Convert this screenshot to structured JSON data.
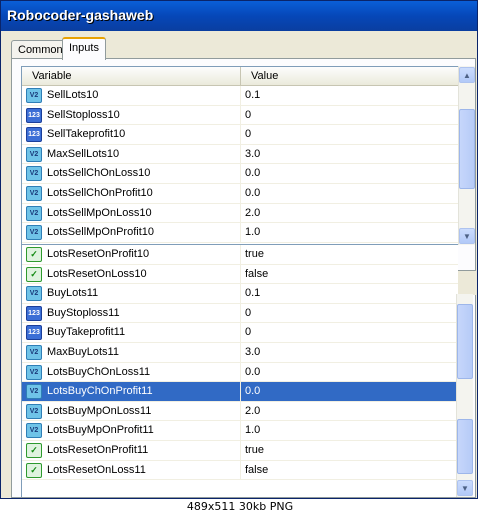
{
  "window": {
    "title": "Robocoder-gashaweb"
  },
  "tabs": [
    {
      "label": "Common",
      "active": false
    },
    {
      "label": "Inputs",
      "active": true
    }
  ],
  "table": {
    "headers": {
      "variable": "Variable",
      "value": "Value"
    },
    "top_rows": [
      {
        "icon": "double",
        "name": "SellLots10",
        "value": "0.1"
      },
      {
        "icon": "int",
        "name": "SellStoploss10",
        "value": "0"
      },
      {
        "icon": "int",
        "name": "SellTakeprofit10",
        "value": "0"
      },
      {
        "icon": "double",
        "name": "MaxSellLots10",
        "value": "3.0"
      },
      {
        "icon": "double",
        "name": "LotsSellChOnLoss10",
        "value": "0.0"
      },
      {
        "icon": "double",
        "name": "LotsSellChOnProfit10",
        "value": "0.0"
      },
      {
        "icon": "double",
        "name": "LotsSellMpOnLoss10",
        "value": "2.0"
      },
      {
        "icon": "double",
        "name": "LotsSellMpOnProfit10",
        "value": "1.0"
      }
    ],
    "bottom_rows": [
      {
        "icon": "bool",
        "name": "LotsResetOnProfit10",
        "value": "true"
      },
      {
        "icon": "bool",
        "name": "LotsResetOnLoss10",
        "value": "false"
      },
      {
        "icon": "double",
        "name": "BuyLots11",
        "value": "0.1"
      },
      {
        "icon": "int",
        "name": "BuyStoploss11",
        "value": "0"
      },
      {
        "icon": "int",
        "name": "BuyTakeprofit11",
        "value": "0"
      },
      {
        "icon": "double",
        "name": "MaxBuyLots11",
        "value": "3.0"
      },
      {
        "icon": "double",
        "name": "LotsBuyChOnLoss11",
        "value": "0.0"
      },
      {
        "icon": "double",
        "name": "LotsBuyChOnProfit11",
        "value": "0.0",
        "selected": true
      },
      {
        "icon": "double",
        "name": "LotsBuyMpOnLoss11",
        "value": "2.0"
      },
      {
        "icon": "double",
        "name": "LotsBuyMpOnProfit11",
        "value": "1.0"
      },
      {
        "icon": "bool",
        "name": "LotsResetOnProfit11",
        "value": "true"
      },
      {
        "icon": "bool",
        "name": "LotsResetOnLoss11",
        "value": "false"
      }
    ]
  },
  "icon_glyphs": {
    "double": "V2",
    "int": "123",
    "bool": "✓"
  },
  "status": "489x511  30kb  PNG",
  "colors": {
    "titlebar": "#0a5fd8",
    "selection": "#316ac5",
    "tab_accent": "#e8a202"
  }
}
